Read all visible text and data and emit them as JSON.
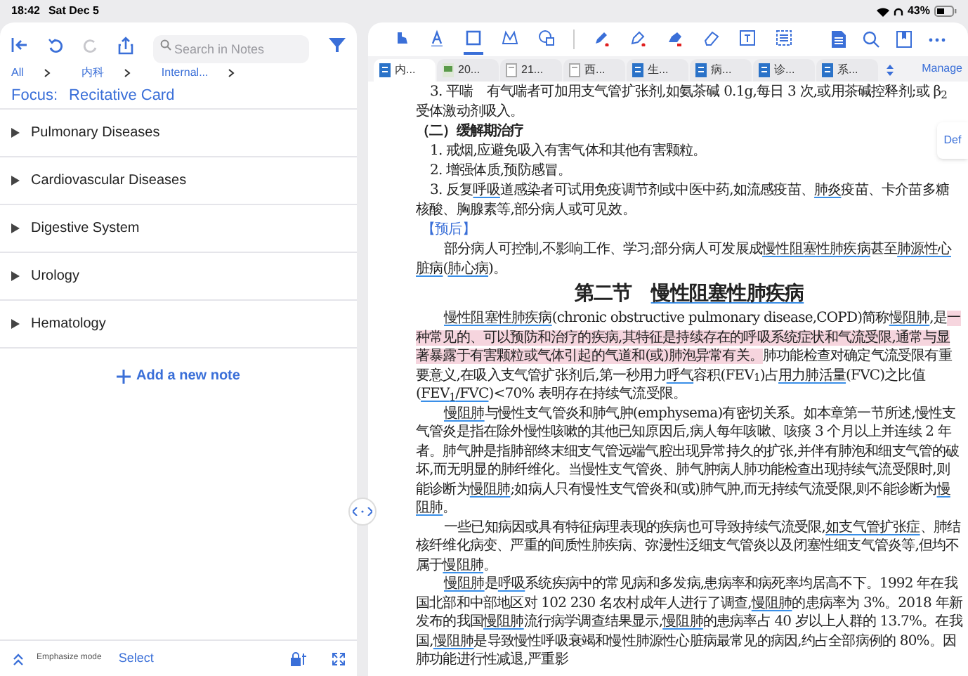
{
  "status_bar": {
    "time": "18:42",
    "date": "Sat Dec 5",
    "battery": "43%"
  },
  "notes_panel": {
    "search": {
      "placeholder": "Search in Notes"
    },
    "breadcrumb": [
      "All",
      "内科",
      "Internal..."
    ],
    "focus": {
      "label": "Focus:",
      "value": "Recitative Card"
    },
    "items": [
      {
        "label": "Pulmonary Diseases",
        "expanded": false
      },
      {
        "label": "Cardiovascular Diseases",
        "expanded": false
      },
      {
        "label": "Digestive System",
        "expanded": false
      },
      {
        "label": "Urology",
        "expanded": false
      },
      {
        "label": "Hematology",
        "expanded": false
      }
    ],
    "add_note": "Add a new note",
    "bottom_bar": {
      "mode": "Emphasize mode",
      "select": "Select"
    }
  },
  "toolbar": {
    "tools": [
      {
        "kind": "hand",
        "selected": false
      },
      {
        "kind": "text",
        "selected": false
      },
      {
        "kind": "rect",
        "selected": true
      },
      {
        "kind": "lasso",
        "selected": false
      },
      {
        "kind": "shape",
        "selected": false
      },
      {
        "kind": "pen",
        "selected": false
      },
      {
        "kind": "marker",
        "selected": false
      },
      {
        "kind": "highlighter",
        "selected": false
      },
      {
        "kind": "eraser",
        "selected": false
      },
      {
        "kind": "textbox",
        "selected": false
      },
      {
        "kind": "list",
        "selected": false
      }
    ]
  },
  "tabs": [
    {
      "label": "内...",
      "kind": "book",
      "selected": true
    },
    {
      "label": "20...",
      "kind": "image",
      "selected": false
    },
    {
      "label": "21...",
      "kind": "page",
      "selected": false
    },
    {
      "label": "西...",
      "kind": "page",
      "selected": false
    },
    {
      "label": "生...",
      "kind": "book",
      "selected": false
    },
    {
      "label": "病...",
      "kind": "book",
      "selected": false
    },
    {
      "label": "诊...",
      "kind": "book",
      "selected": false
    },
    {
      "label": "系...",
      "kind": "book",
      "selected": false
    }
  ],
  "manage": "Manage",
  "def_button": "Def",
  "document": [
    {
      "kind": "numbered",
      "segments": [
        {
          "kind": "plain",
          "text": "3. 平喘　有气喘者可加用支气管扩张剂,如氨茶碱 0.1g,每日 3 次,或用茶碱控释剂;或 β$_{2}$ 受体激动剂吸入。"
        }
      ]
    },
    {
      "kind": "subheading",
      "segments": [
        {
          "kind": "plain",
          "text": "（二）缓解期治疗"
        }
      ]
    },
    {
      "kind": "numbered",
      "segments": [
        {
          "kind": "plain",
          "text": "1. 戒烟,应避免吸入有害气体和其他有害颗粒。"
        }
      ]
    },
    {
      "kind": "numbered",
      "segments": [
        {
          "kind": "plain",
          "text": "2. 增强体质,预防感冒。"
        }
      ]
    },
    {
      "kind": "numbered",
      "segments": [
        {
          "kind": "plain",
          "text": "3. 反复"
        },
        {
          "kind": "term",
          "text": "呼吸"
        },
        {
          "kind": "plain",
          "text": "道感染者可试用免疫调节剂或中医中药,如流感疫苗、"
        },
        {
          "kind": "term",
          "text": "肺炎"
        },
        {
          "kind": "plain",
          "text": "疫苗、卡介苗多糖核酸、胸腺素等,部分病人或可见效。"
        }
      ]
    },
    {
      "kind": "label",
      "segments": [
        {
          "kind": "plain",
          "text": "【预后】"
        }
      ]
    },
    {
      "kind": "body",
      "segments": [
        {
          "kind": "plain",
          "text": "部分病人可控制,不影响工作、学习;部分病人可发展成"
        },
        {
          "kind": "term",
          "text": "慢性阻塞性肺疾病"
        },
        {
          "kind": "plain",
          "text": "甚至"
        },
        {
          "kind": "term",
          "text": "肺源性心脏病"
        },
        {
          "kind": "plain",
          "text": "("
        },
        {
          "kind": "term",
          "text": "肺心病"
        },
        {
          "kind": "plain",
          "text": ")。"
        }
      ]
    },
    {
      "kind": "title",
      "segments": [
        {
          "kind": "plain",
          "text": "第二节　"
        },
        {
          "kind": "term",
          "text": "慢性阻塞性肺疾病"
        }
      ]
    },
    {
      "kind": "body",
      "segments": [
        {
          "kind": "term",
          "text": "慢性阻塞性肺疾病"
        },
        {
          "kind": "plain",
          "text": "(chronic obstructive pulmonary disease,COPD)简称"
        },
        {
          "kind": "term",
          "text": "慢阻肺"
        },
        {
          "kind": "plain",
          "text": ",是"
        },
        {
          "kind": "highlight",
          "text": "一种常见的、可以预防和治疗的疾病,其特征是持续存在的呼吸系统症状和气流受限,通常与显著暴露于有害颗粒或气体引起的气道和(或)肺泡异常有关。"
        },
        {
          "kind": "plain",
          "text": "肺功能检查对确定气流受限有重要意义,在吸入支气管扩张剂后,第一秒用力"
        },
        {
          "kind": "term",
          "text": "呼气"
        },
        {
          "kind": "plain",
          "text": "容积(FEV$_{1}$)占"
        },
        {
          "kind": "term",
          "text": "用力肺活量"
        },
        {
          "kind": "plain",
          "text": "(FVC)之比值("
        },
        {
          "kind": "term",
          "text": "FEV$_{1}$/FVC"
        },
        {
          "kind": "plain",
          "text": ")<70% 表明存在持续气流受限。"
        }
      ]
    },
    {
      "kind": "body",
      "segments": [
        {
          "kind": "term",
          "text": "慢阻肺"
        },
        {
          "kind": "plain",
          "text": "与慢性支气管炎和肺气肿(emphysema)有密切关系。如本章第一节所述,慢性支气管炎是指在除外慢性咳嗽的其他已知原因后,病人每年咳嗽、咳痰 3 个月以上并连续 2 年者。肺气肿是指肺部终末细支气管远端气腔出现异常持久的扩张,并伴有肺泡和细支气管的破坏,而无明显的肺纤维化。当慢性支气管炎、肺气肿病人肺功能检查出现持续气流受限时,则能诊断为"
        },
        {
          "kind": "term",
          "text": "慢阻肺"
        },
        {
          "kind": "plain",
          "text": ";如病人只有慢性支气管炎和(或)肺气肿,而无持续气流受限,则不能诊断为"
        },
        {
          "kind": "term",
          "text": "慢阻肺"
        },
        {
          "kind": "plain",
          "text": "。"
        }
      ]
    },
    {
      "kind": "body",
      "segments": [
        {
          "kind": "plain",
          "text": "一些已知病因或具有特征病理表现的疾病也可导致持续气流受限,"
        },
        {
          "kind": "term",
          "text": "如支气管扩张症"
        },
        {
          "kind": "plain",
          "text": "、肺结核纤维化病变、严重的间质性肺疾病、弥漫性泛细支气管炎以及闭塞性细支气管炎等,但均不属于"
        },
        {
          "kind": "term",
          "text": "慢阻肺"
        },
        {
          "kind": "plain",
          "text": "。"
        }
      ]
    },
    {
      "kind": "body",
      "segments": [
        {
          "kind": "term",
          "text": "慢阻肺"
        },
        {
          "kind": "plain",
          "text": "是"
        },
        {
          "kind": "term",
          "text": "呼吸"
        },
        {
          "kind": "plain",
          "text": "系统疾病中的常见病和多发病,患病率和病死率均居高不下。1992 年在我国北部和中部地区对 102 230 名农村成年人进行了调查,"
        },
        {
          "kind": "term",
          "text": "慢阻肺"
        },
        {
          "kind": "plain",
          "text": "的患病率为 3%。2018 年新发布的我国"
        },
        {
          "kind": "term",
          "text": "慢阻肺"
        },
        {
          "kind": "plain",
          "text": "流行病学调查结果显示,"
        },
        {
          "kind": "term",
          "text": "慢阻肺"
        },
        {
          "kind": "plain",
          "text": "的患病率占 40 岁以上人群的 13.7%。在我国,"
        },
        {
          "kind": "term",
          "text": "慢阻肺"
        },
        {
          "kind": "plain",
          "text": "是导致慢性呼吸衰竭和慢性肺源性心脏病最常见的病因,约占全部病例的 80%。因肺功能进行性减退,严重影"
        }
      ]
    }
  ]
}
